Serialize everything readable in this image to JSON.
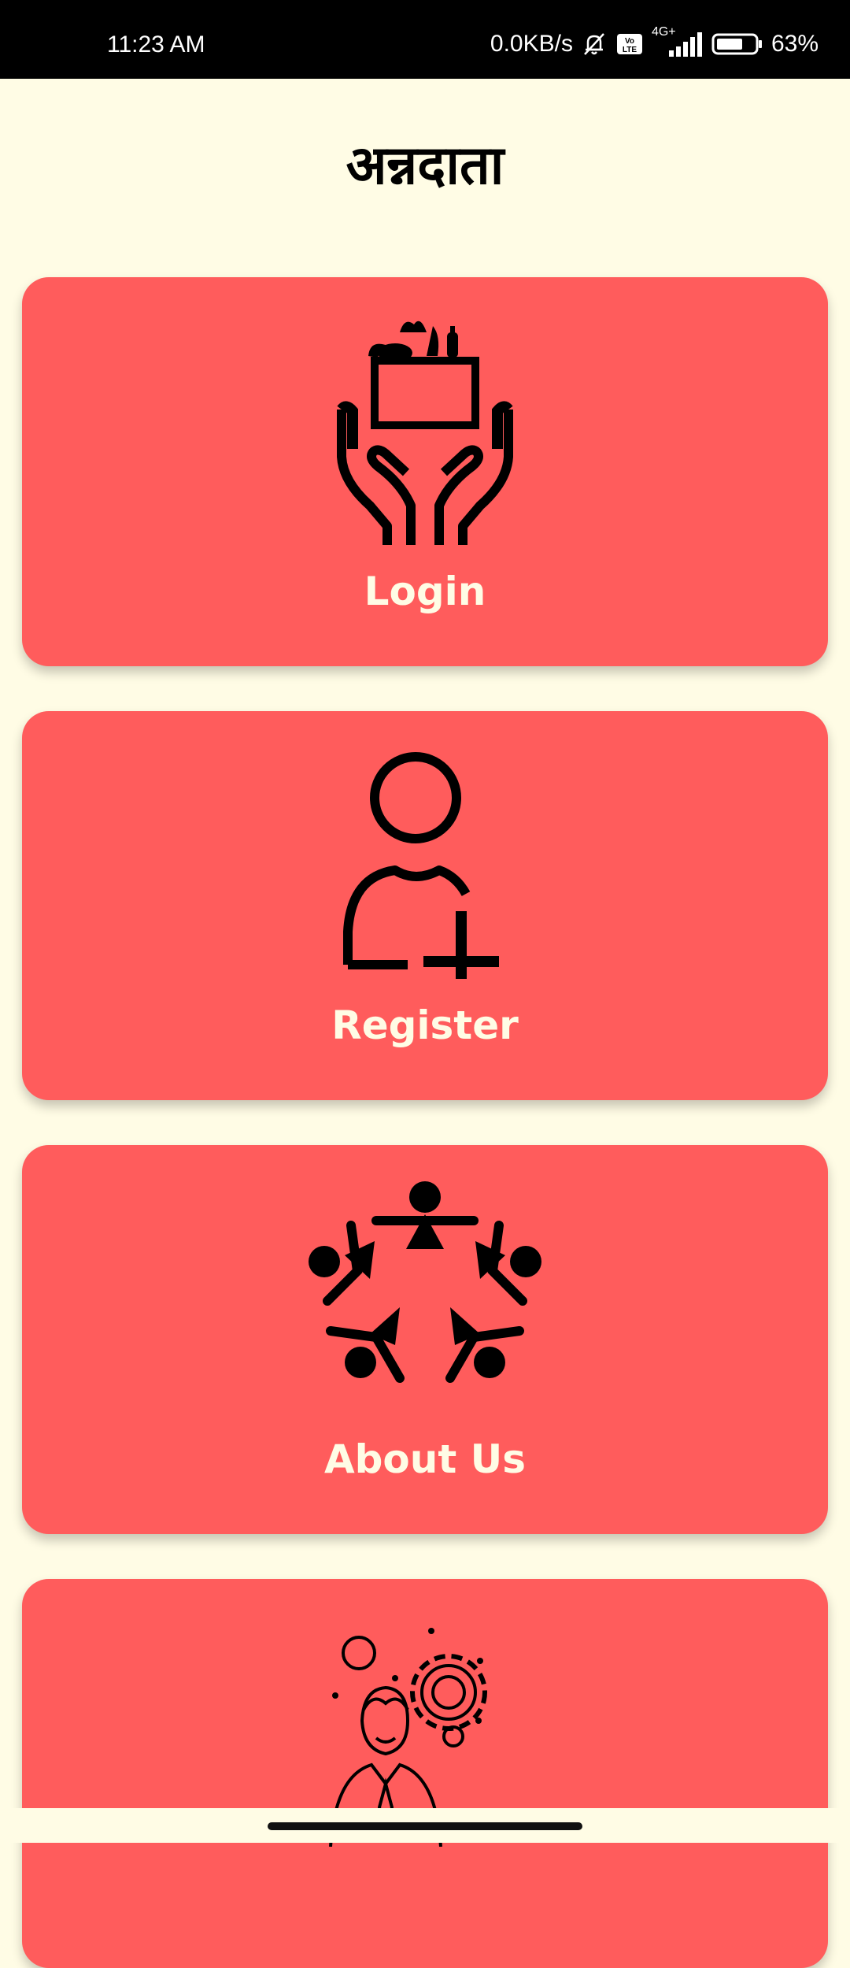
{
  "status_bar": {
    "time": "11:23 AM",
    "network_speed": "0.0KB/s",
    "volte": "Vo LTE",
    "network_type": "4G+",
    "battery": "63%"
  },
  "app": {
    "title": "अन्नदाता"
  },
  "cards": [
    {
      "label": "Login",
      "icon": "food-donation-hands-icon"
    },
    {
      "label": "Register",
      "icon": "add-user-icon"
    },
    {
      "label": "About Us",
      "icon": "community-circle-icon"
    },
    {
      "label": "",
      "icon": "support-person-gear-icon"
    }
  ],
  "colors": {
    "background": "#FFFCE5",
    "card": "#FF5C5C",
    "card_text": "#FFFCE5",
    "status_bar": "#000000"
  }
}
